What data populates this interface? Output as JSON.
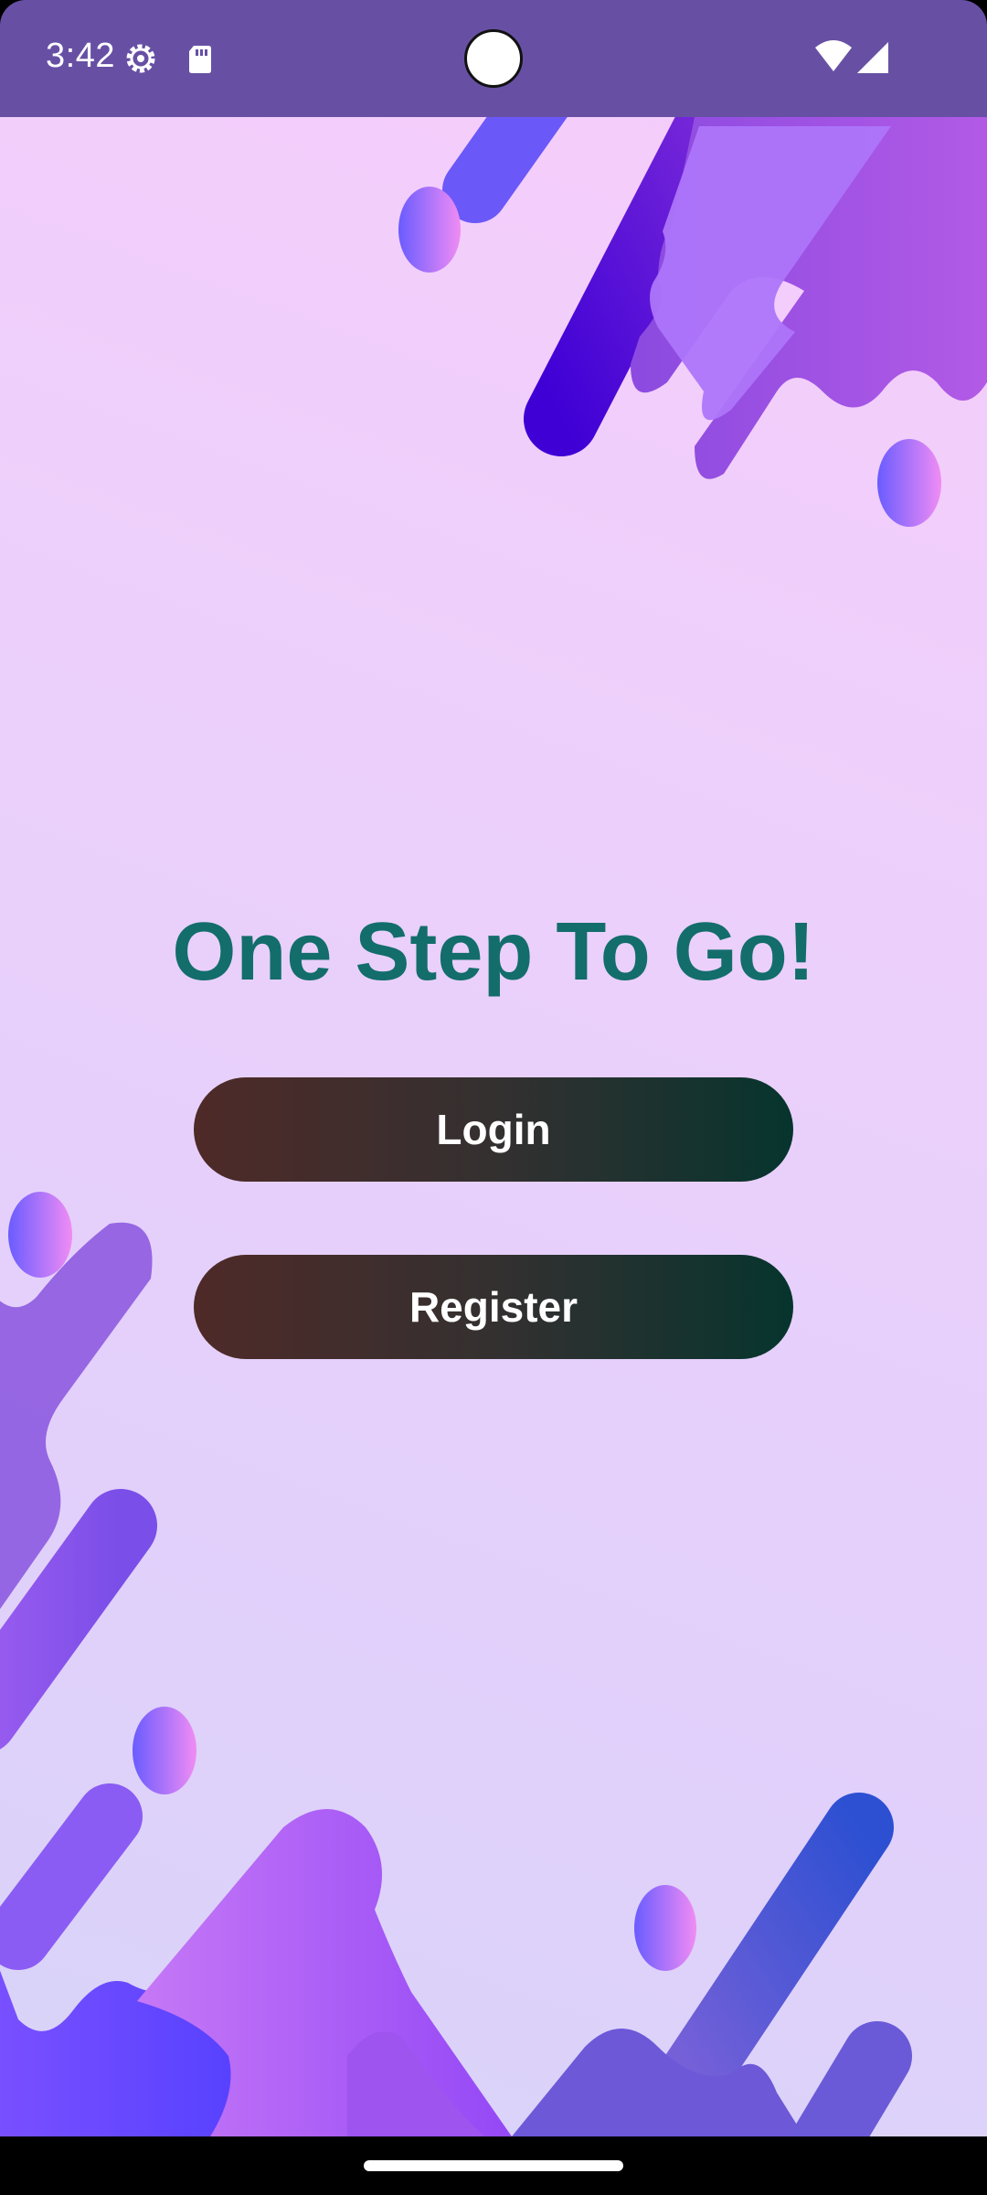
{
  "status_bar": {
    "time": "3:42",
    "icons": [
      "settings-gear-icon",
      "sd-card-icon",
      "wifi-icon",
      "cellular-signal-icon"
    ],
    "background_color": "#6750a4"
  },
  "main": {
    "title": "One Step To Go!",
    "title_color": "#136d6b",
    "login_label": "Login",
    "register_label": "Register"
  },
  "nav_bar": {
    "icons": [
      "home-gesture-handle"
    ]
  }
}
